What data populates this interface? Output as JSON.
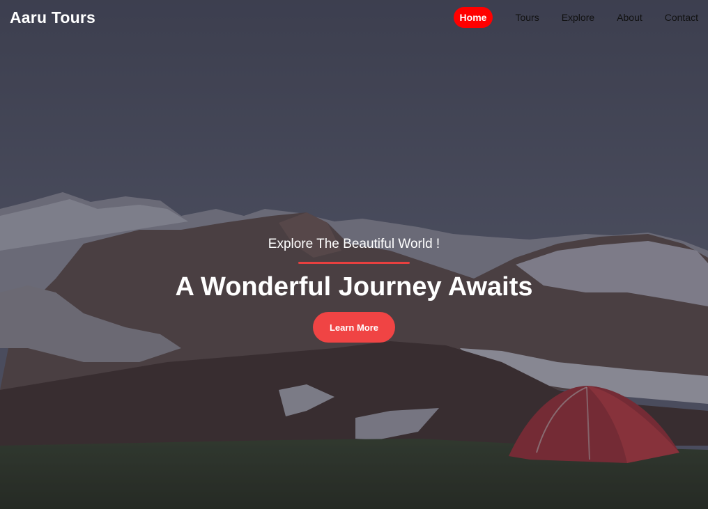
{
  "header": {
    "brand": "Aaru Tours",
    "nav": [
      {
        "label": "Home",
        "active": true
      },
      {
        "label": "Tours",
        "active": false
      },
      {
        "label": "Explore",
        "active": false
      },
      {
        "label": "About",
        "active": false
      },
      {
        "label": "Contact",
        "active": false
      }
    ]
  },
  "hero": {
    "tagline": "Explore The Beautiful World !",
    "headline": "A Wonderful Journey Awaits",
    "cta_label": "Learn More"
  },
  "colors": {
    "accent": "#ff0000",
    "button": "#f04444",
    "divider": "#e8403f",
    "overlay": "#3b3c4c"
  }
}
